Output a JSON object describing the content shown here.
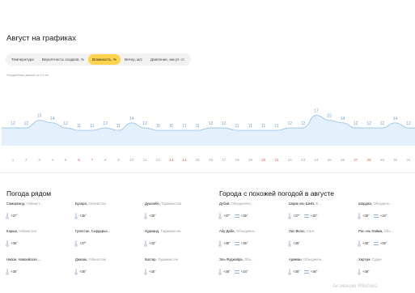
{
  "page": {
    "title": "Август на графиках"
  },
  "tabs": [
    {
      "label": "Температура",
      "active": false
    },
    {
      "label": "Вероятность осадков, %",
      "active": false
    },
    {
      "label": "Влажность, %",
      "active": true
    },
    {
      "label": "Ветер, м/с",
      "active": false
    },
    {
      "label": "Давление, мм рт. ст.",
      "active": false
    }
  ],
  "chart_note": "Усреднённые данные за 10 лет",
  "chart_data": {
    "type": "area",
    "title": "",
    "xlabel": "",
    "ylabel": "",
    "x": [
      1,
      2,
      3,
      4,
      5,
      6,
      7,
      8,
      9,
      10,
      11,
      12,
      13,
      14,
      15,
      16,
      17,
      18,
      19,
      20,
      21,
      22,
      23,
      24,
      25,
      26,
      27,
      28,
      29,
      30,
      31
    ],
    "values": [
      12,
      12,
      15,
      14,
      12,
      11,
      11,
      12,
      11,
      14,
      12,
      11,
      11,
      11,
      11,
      12,
      12,
      11,
      11,
      11,
      11,
      12,
      12,
      17,
      15,
      14,
      12,
      12,
      12,
      14,
      12
    ],
    "weekend_days": [
      6,
      7,
      13,
      14,
      20,
      21,
      27,
      28
    ],
    "colors": {
      "line": "#9ec5ea",
      "fill": "#e4f0fb",
      "values": "#6a9fd4",
      "weekday": "#8fa8c2",
      "weekend": "#e5574a"
    }
  },
  "nearby": {
    "title": "Погода рядом",
    "cities": [
      {
        "name": "Самарканд,",
        "country": "Узбекист...",
        "temp": "+37°"
      },
      {
        "name": "Бухара,",
        "country": "Узбекистан",
        "temp": "+35°"
      },
      {
        "name": "Душанбе,",
        "country": "Таджикистан",
        "temp": "+36°"
      },
      {
        "name": "Карши,",
        "country": "Узбекистан",
        "temp": "+36°"
      },
      {
        "name": "Гулистан, Сырдарьи...",
        "country": "",
        "temp": "+37°"
      },
      {
        "name": "Худжанд,",
        "country": "Таджикистан",
        "temp": "+33°"
      },
      {
        "name": "Навои, Навоийская ...",
        "country": "",
        "temp": "+35°"
      },
      {
        "name": "Джизак,",
        "country": "Узбекистан",
        "temp": "+35°"
      },
      {
        "name": "Бохтар,",
        "country": "Таджикистан",
        "temp": "+35°"
      }
    ]
  },
  "similar": {
    "title": "Города с похожей погодой в августе",
    "cities": [
      {
        "name": "Дубай,",
        "country": "Объединенн...",
        "temp": "+37°",
        "water": "+36°"
      },
      {
        "name": "Шарм-эль-Шейх,",
        "country": "Е...",
        "temp": "+37°",
        "water": "+30°"
      },
      {
        "name": "Шарджа,",
        "country": "Объедине...",
        "temp": "+36°",
        "water": "+34°"
      },
      {
        "name": "Абу-Даби,",
        "country": "Объединен...",
        "temp": "+38°",
        "water": "+35°"
      },
      {
        "name": "Лас-Вегас,",
        "country": "США",
        "temp": "+36°",
        "water": ""
      },
      {
        "name": "Рас-эль-Хайма,",
        "country": "Объ...",
        "temp": "+36°",
        "water": "+35°"
      },
      {
        "name": "Эль-Фуджайра,",
        "country": "Объ...",
        "temp": "+36°",
        "water": "+34°"
      },
      {
        "name": "Аджман,",
        "country": "Объединен...",
        "temp": "+38°",
        "water": "+36°"
      },
      {
        "name": "Хартум,",
        "country": "Судан",
        "temp": "+36°",
        "water": ""
      }
    ]
  },
  "watermark": "Активация Windows"
}
